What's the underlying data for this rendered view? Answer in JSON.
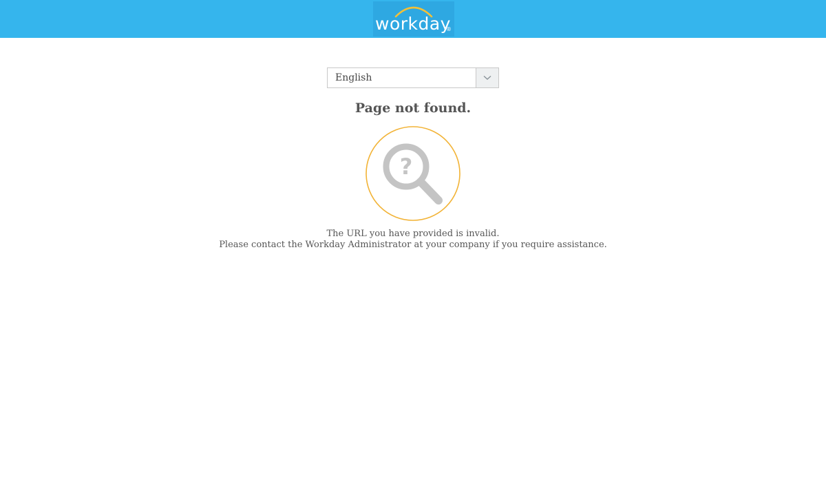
{
  "header": {
    "logo_text": "workday",
    "logo_registered": "®",
    "brand_color": "#35b5ed",
    "arc_color": "#f3c037"
  },
  "language_select": {
    "value": "English",
    "icon": "chevron-down-icon"
  },
  "error": {
    "title": "Page not found.",
    "illustration_icon": "magnifier-question-icon",
    "ring_color": "#f2b336",
    "line1": "The URL you have provided is invalid.",
    "line2": "Please contact the Workday Administrator at your company if you require assistance."
  }
}
